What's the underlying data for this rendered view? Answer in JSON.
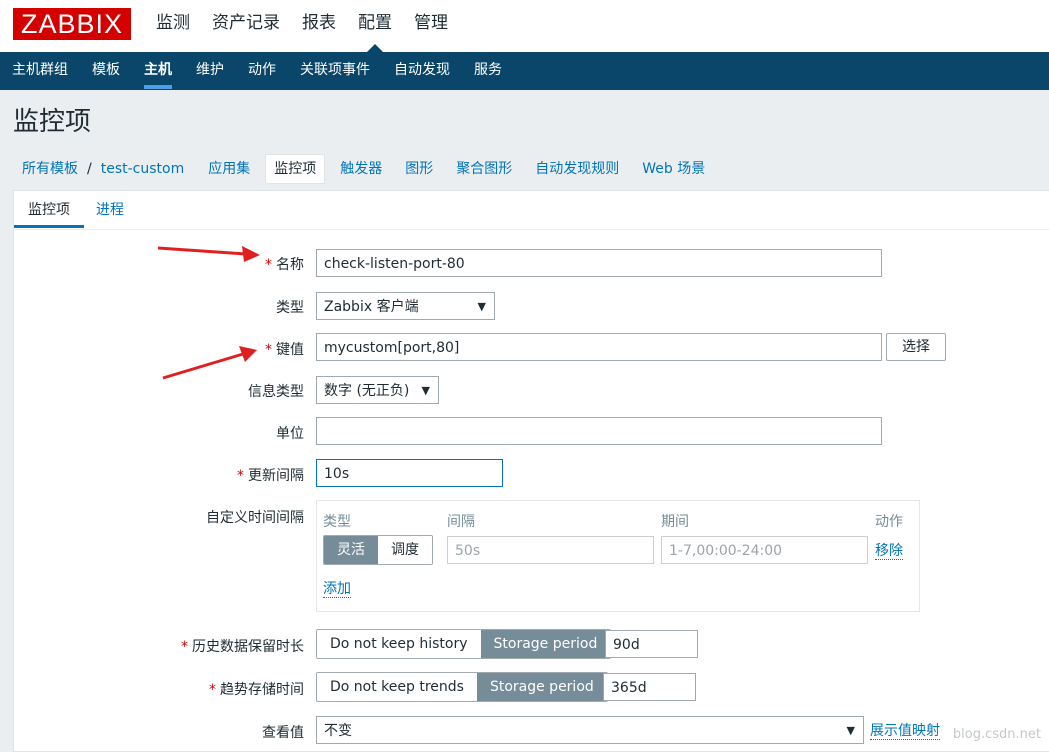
{
  "logo": "ZABBIX",
  "top_menu": [
    "监测",
    "资产记录",
    "报表",
    "配置",
    "管理"
  ],
  "top_menu_active": "配置",
  "sub_menu": [
    "主机群组",
    "模板",
    "主机",
    "维护",
    "动作",
    "关联项事件",
    "自动发现",
    "服务"
  ],
  "sub_menu_active": "主机",
  "page_title": "监控项",
  "breadcrumb": {
    "all_templates": "所有模板",
    "separator": "/",
    "template": "test-custom",
    "items": [
      "应用集",
      "监控项",
      "触发器",
      "图形",
      "聚合图形",
      "自动发现规则",
      "Web 场景"
    ],
    "current": "监控项"
  },
  "tabs": {
    "item": "监控项",
    "process": "进程"
  },
  "form": {
    "name_label": "名称",
    "name_value": "check-listen-port-80",
    "type_label": "类型",
    "type_value": "Zabbix 客户端",
    "key_label": "键值",
    "key_value": "mycustom[port,80]",
    "select_button": "选择",
    "info_type_label": "信息类型",
    "info_type_value": "数字 (无正负)",
    "units_label": "单位",
    "units_value": "",
    "interval_label": "更新间隔",
    "interval_value": "10s",
    "custom_intervals_label": "自定义时间间隔",
    "custom": {
      "col_type": "类型",
      "col_interval": "间隔",
      "col_period": "期间",
      "col_action": "动作",
      "flexible": "灵活",
      "scheduling": "调度",
      "interval_placeholder": "50s",
      "period_placeholder": "1-7,00:00-24:00",
      "remove": "移除",
      "add": "添加"
    },
    "history_label": "历史数据保留时长",
    "history_no_keep": "Do not keep history",
    "history_storage": "Storage period",
    "history_value": "90d",
    "trends_label": "趋势存储时间",
    "trends_no_keep": "Do not keep trends",
    "trends_storage": "Storage period",
    "trends_value": "365d",
    "show_value_label": "查看值",
    "show_value_value": "不变",
    "value_mapping_link": "展示值映射"
  },
  "watermark": "blog.csdn.net",
  "colors": {
    "brand": "#d40000",
    "nav": "#0a466a",
    "link": "#0275b8",
    "annotation_arrow": "#e02020"
  }
}
